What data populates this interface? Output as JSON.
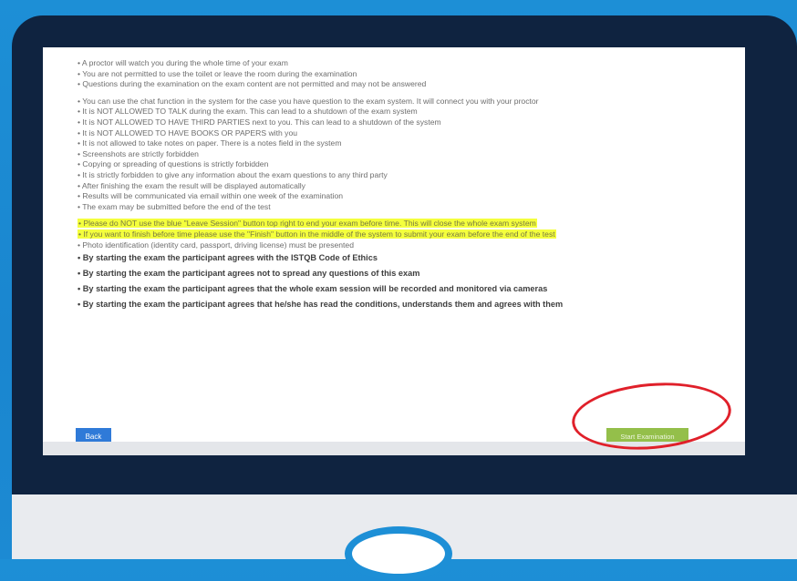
{
  "rules": {
    "group1": [
      "• A proctor will watch you during the whole time of your exam",
      "• You are not permitted to use the toilet or leave the room during the examination",
      "• Questions during the examination on the exam content are not permitted and may not be answered"
    ],
    "group2": [
      "• You can use the chat function in the system for the case you have question to the exam system. It will connect you with your proctor",
      "• It is NOT ALLOWED TO TALK during the exam. This can lead to a shutdown of the exam system",
      "• It is NOT ALLOWED TO HAVE THIRD PARTIES next to you. This can lead to a shutdown of the system",
      "• It is NOT ALLOWED TO HAVE BOOKS OR PAPERS with you",
      "• It is not allowed to take notes on paper. There is a notes field in the system",
      "• Screenshots are strictly forbidden",
      "• Copying or spreading of questions is strictly forbidden",
      "• It is strictly forbidden to give any information about the exam questions to any third party",
      "• After finishing the exam the result will be displayed automatically",
      "• Results will be communicated via email within one week of the examination",
      "• The exam may be submitted before the end of the test"
    ],
    "highlighted": [
      "• Please do NOT use the blue \"Leave Session\" button top right to end your exam before time. This will close the whole exam system",
      "• If you want to finish before time please use the \"Finish\" button in the middle of the system to submit your exam before the end of the test"
    ],
    "photo_id": "• Photo identification (identity card, passport, driving license) must be presented",
    "agreements": [
      "• By starting the exam the participant agrees with the ISTQB Code of Ethics",
      "• By starting the exam the participant agrees not to spread any questions of this exam",
      "• By starting the exam the participant agrees that the whole exam session will be recorded and monitored via cameras",
      "• By starting the exam the participant agrees that he/she has read the conditions, understands them and agrees with them"
    ]
  },
  "buttons": {
    "back": "Back",
    "start": "Start Examination"
  },
  "colors": {
    "highlight": "#f4ff3d",
    "back_button": "#2f7ad8",
    "start_button": "#94bf4a",
    "annotation_circle": "#e0202a",
    "frame": "#0f2340",
    "background": "#1d8fd6"
  }
}
